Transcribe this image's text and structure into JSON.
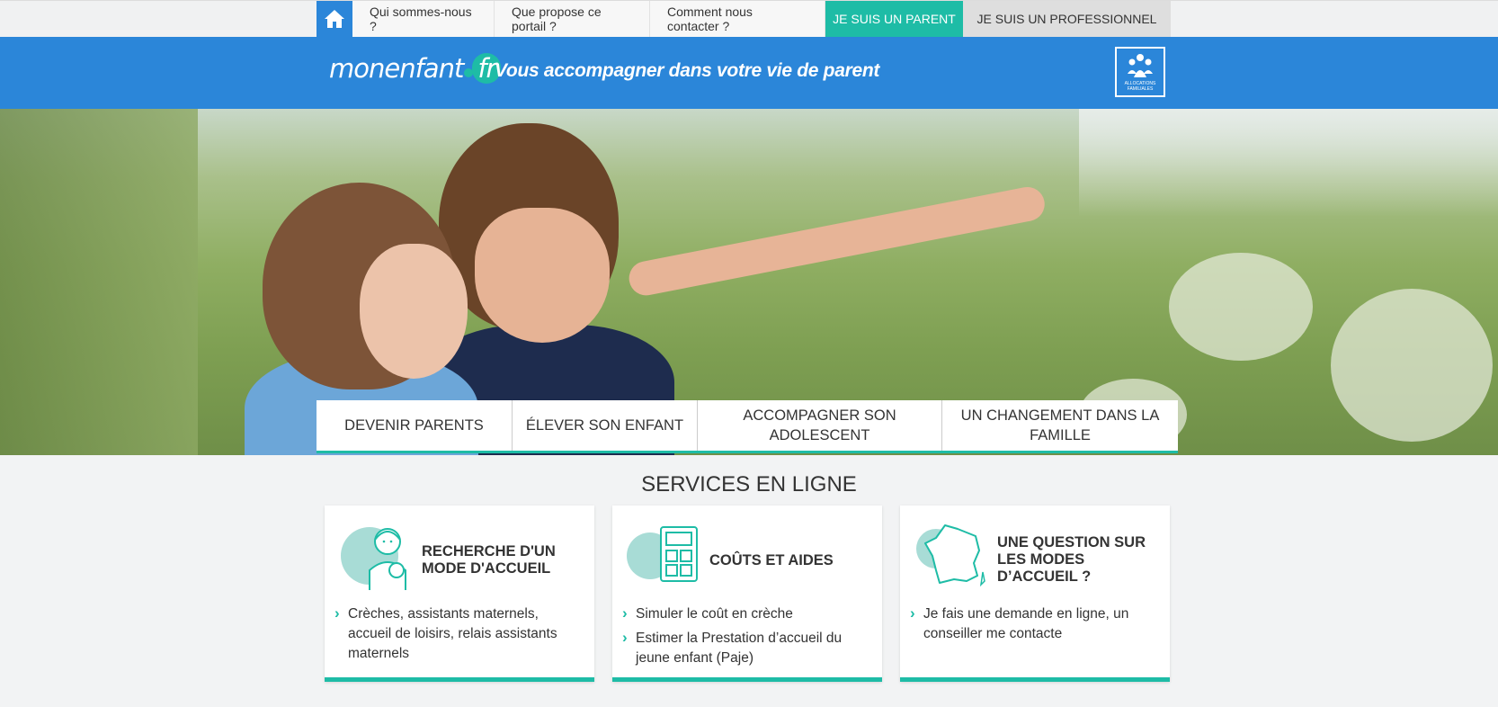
{
  "topnav": {
    "home_icon": "home-icon",
    "links": [
      "Qui sommes-nous ?",
      "Que propose ce portail ?",
      "Comment nous contacter ?"
    ],
    "parent_label": "JE SUIS UN PARENT",
    "pro_label": "JE SUIS UN PROFESSIONNEL"
  },
  "header": {
    "logo_main": "monenfant",
    "logo_suffix": "fr",
    "tagline": "Vous accompagner dans votre vie de parent",
    "caf_text": "ALLOCATIONS FAMILIALES"
  },
  "categories": [
    "Devenir parents",
    "Élever son enfant",
    "Accompagner son adolescent",
    "Un changement dans la famille"
  ],
  "services": {
    "title": "SERVICES EN LIGNE",
    "cards": [
      {
        "title": "Recherche d'un mode d'accueil",
        "items": [
          "Crèches, assistants maternels, accueil de loisirs, relais assistants maternels"
        ]
      },
      {
        "title": "Coûts et aides",
        "items": [
          "Simuler le coût en crèche",
          "Estimer la Prestation d’accueil du jeune enfant (Paje)"
        ]
      },
      {
        "title": "Une question sur les modes d’accueil ?",
        "items": [
          "Je fais une demande en ligne, un conseiller me contacte"
        ]
      }
    ]
  },
  "colors": {
    "brand_blue": "#2b86d9",
    "accent_teal": "#1ebca6"
  }
}
